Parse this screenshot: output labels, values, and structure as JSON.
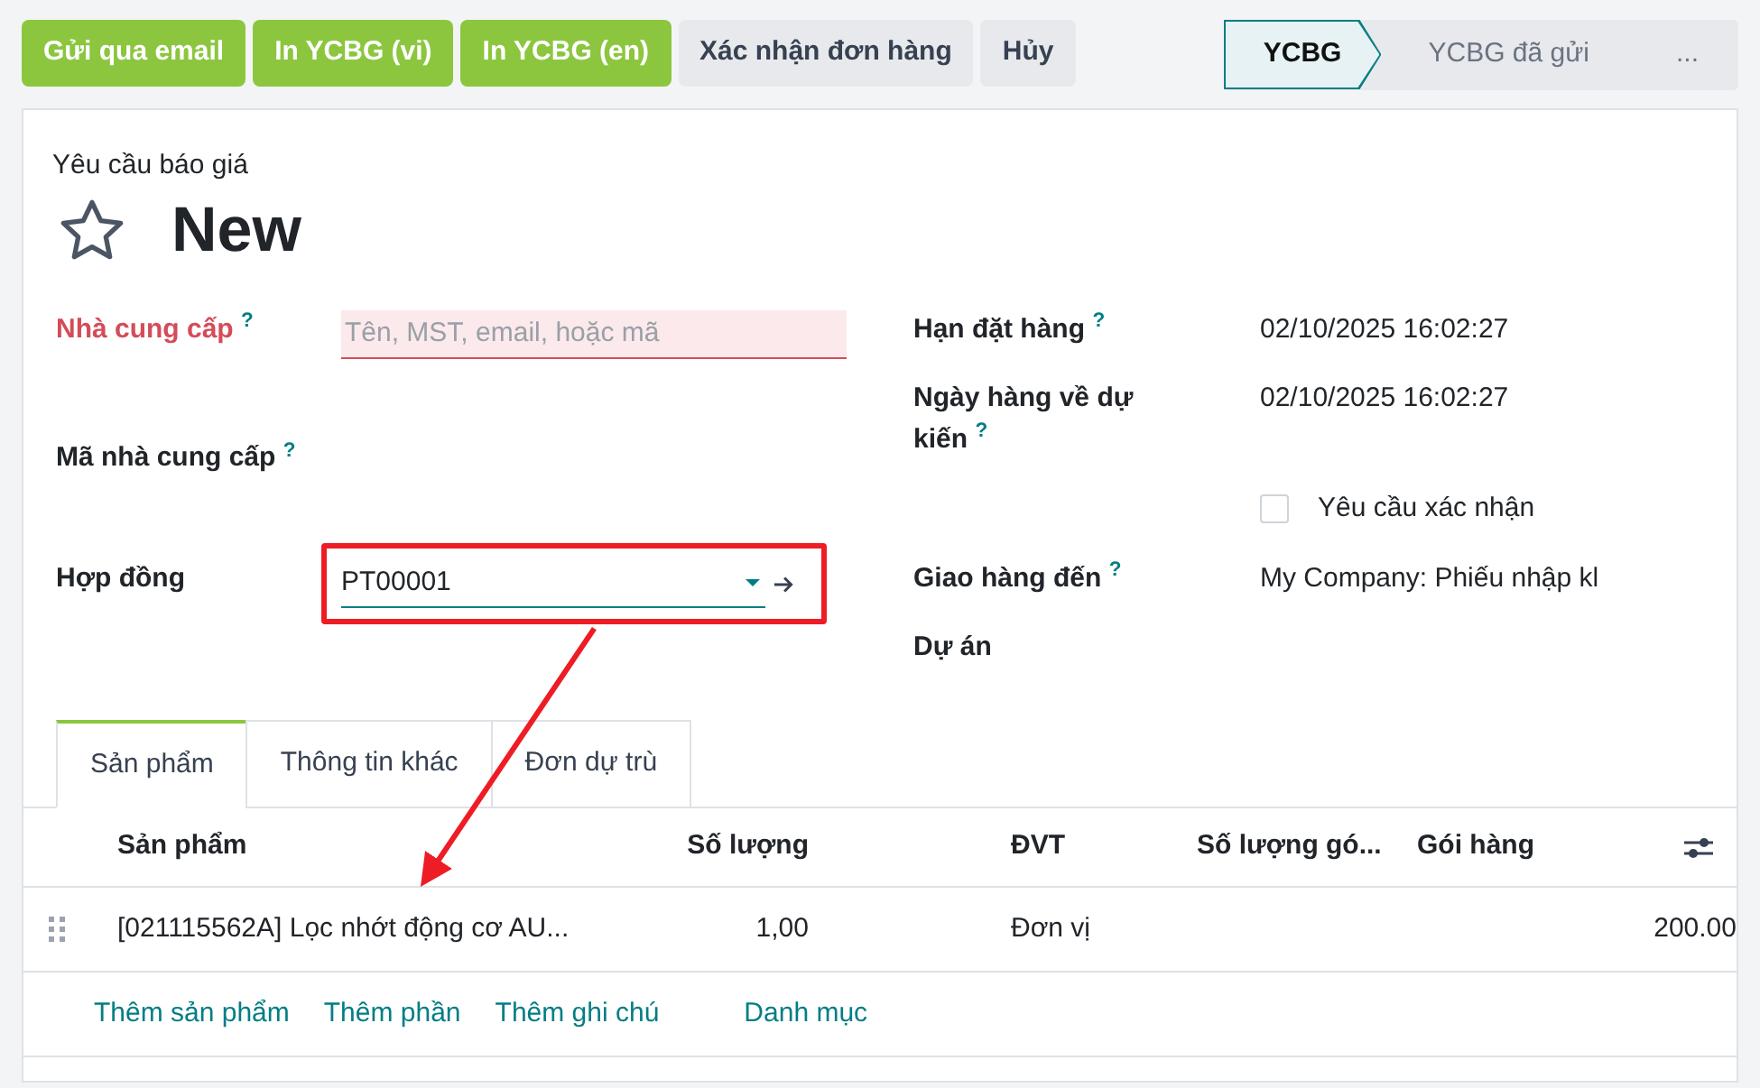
{
  "actions": [
    {
      "label": "Gửi qua email",
      "kind": "primary"
    },
    {
      "label": "In YCBG (vi)",
      "kind": "primary"
    },
    {
      "label": "In YCBG (en)",
      "kind": "primary"
    },
    {
      "label": "Xác nhận đơn hàng",
      "kind": "secondary"
    },
    {
      "label": "Hủy",
      "kind": "secondary"
    }
  ],
  "status_steps": [
    {
      "label": "YCBG",
      "selected": true
    },
    {
      "label": "YCBG đã gửi",
      "selected": false
    },
    {
      "label": "...",
      "selected": false
    }
  ],
  "form": {
    "subtitle": "Yêu cầu báo giá",
    "title": "New",
    "starred": false,
    "left_fields": [
      {
        "kind": "text",
        "label": "Nhà cung cấp",
        "help": "?",
        "required": true,
        "placeholder": "Tên, MST, email, hoặc mã"
      },
      {
        "kind": "empty",
        "label": "Mã nhà cung cấp",
        "help": "?",
        "required": false
      },
      {
        "kind": "select",
        "label": "Hợp đồng",
        "required": false,
        "value": "PT00001",
        "highlighted": true
      }
    ],
    "right_fields": [
      {
        "kind": "value",
        "label": "Hạn đặt hàng",
        "help": "?",
        "value": "02/10/2025 16:02:27"
      },
      {
        "kind": "value",
        "label": "Ngày hàng về dự kiến",
        "help": "?",
        "value": "02/10/2025 16:02:27"
      },
      {
        "kind": "checkbox",
        "label": "Yêu cầu xác nhận",
        "checked": false
      },
      {
        "kind": "value",
        "label": "Giao hàng đến",
        "help": "?",
        "value": "My Company: Phiếu nhập kl"
      },
      {
        "kind": "empty",
        "label": "Dự án"
      }
    ]
  },
  "tabs": [
    {
      "label": "Sản phẩm",
      "selected": true
    },
    {
      "label": "Thông tin khác",
      "selected": false
    },
    {
      "label": "Đơn dự trù",
      "selected": false
    }
  ],
  "table": {
    "columns": [
      "Sản phẩm",
      "Số lượng",
      "ĐVT",
      "Số lượng gó...",
      "Gói hàng"
    ],
    "rows": [
      {
        "cells": [
          "[021115562A] Lọc nhớt động cơ AU...",
          "1,00",
          "Đơn vị",
          "",
          "",
          "200.00"
        ]
      }
    ],
    "footer_links": [
      "Thêm sản phẩm",
      "Thêm phần",
      "Thêm ghi chú",
      "Danh mục"
    ]
  }
}
